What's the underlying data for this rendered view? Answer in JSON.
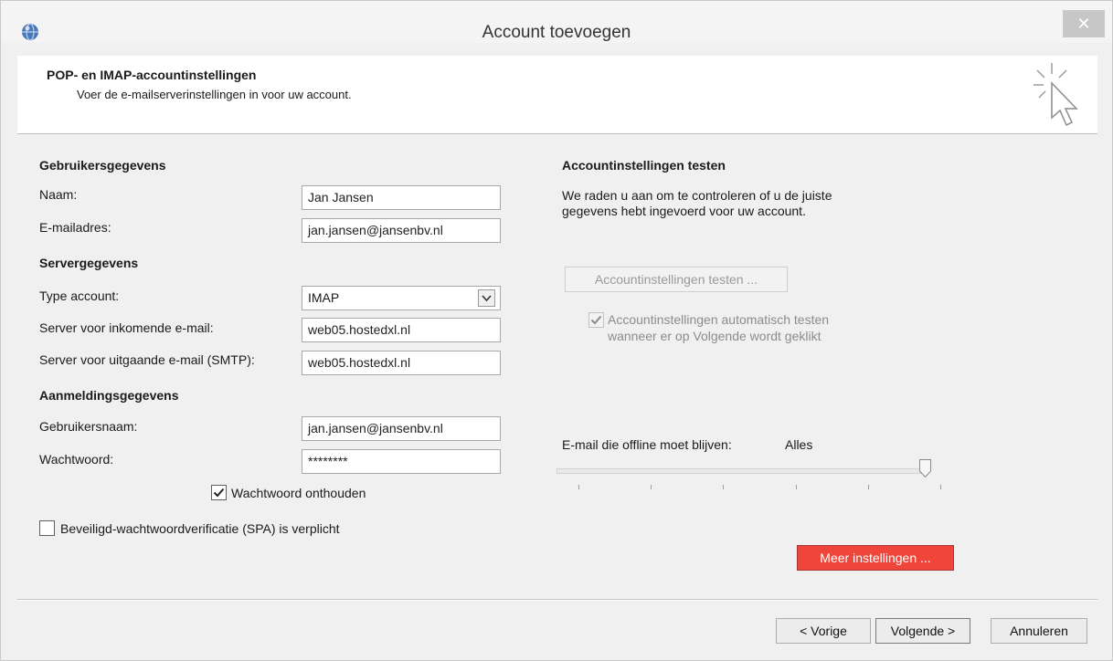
{
  "window": {
    "title": "Account toevoegen",
    "close_glyph": "✕",
    "app_icon": "outlook-globe-icon"
  },
  "header": {
    "title": "POP- en IMAP-accountinstellingen",
    "subtitle": "Voer de e-mailserverinstellingen in voor uw account.",
    "icon": "cursor-sparkle-icon"
  },
  "user": {
    "heading": "Gebruikersgegevens",
    "name_label": "Naam:",
    "name_value": "Jan Jansen",
    "email_label": "E-mailadres:",
    "email_value": "jan.jansen@jansenbv.nl"
  },
  "server": {
    "heading": "Servergegevens",
    "type_label": "Type account:",
    "type_value": "IMAP",
    "incoming_label": "Server voor inkomende e-mail:",
    "incoming_value": "web05.hostedxl.nl",
    "outgoing_label": "Server voor uitgaande e-mail (SMTP):",
    "outgoing_value": "web05.hostedxl.nl"
  },
  "login": {
    "heading": "Aanmeldingsgegevens",
    "username_label": "Gebruikersnaam:",
    "username_value": "jan.jansen@jansenbv.nl",
    "password_label": "Wachtwoord:",
    "password_value": "********",
    "remember_label": "Wachtwoord onthouden",
    "remember_checked": true,
    "spa_label": "Beveiligd-wachtwoordverificatie (SPA) is verplicht",
    "spa_checked": false
  },
  "test": {
    "heading": "Accountinstellingen testen",
    "description_line1": "We raden u aan om te controleren of u de juiste",
    "description_line2": "gegevens hebt ingevoerd voor uw account.",
    "test_button": "Accountinstellingen testen ...",
    "auto_test_line1": "Accountinstellingen automatisch testen",
    "auto_test_line2": "wanneer er op Volgende wordt geklikt",
    "auto_test_checked": true
  },
  "offline": {
    "label": "E-mail die offline moet blijven:",
    "value": "Alles",
    "slider_fraction": 1.0
  },
  "more_settings_button": "Meer instellingen ...",
  "footer": {
    "back_button": "< Vorige",
    "next_button": "Volgende >",
    "cancel_button": "Annuleren"
  },
  "colors": {
    "accent_red": "#f0453a",
    "background": "#f0f0f0"
  }
}
